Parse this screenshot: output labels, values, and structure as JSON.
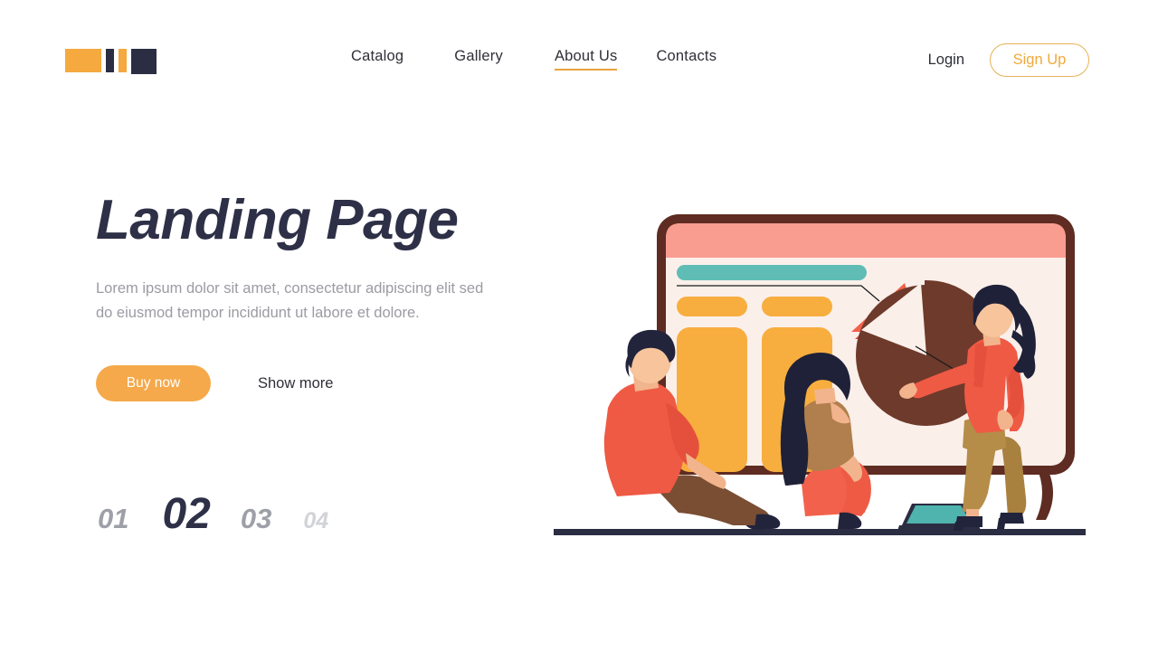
{
  "header": {
    "logo": {
      "name": "brand-logo",
      "colors": [
        "#F5A93F",
        "#2B2D42",
        "#F5A93F",
        "#2B2D42"
      ]
    },
    "nav": [
      {
        "label": "Catalog",
        "active": false
      },
      {
        "label": "Gallery",
        "active": false
      },
      {
        "label": "About Us",
        "active": true
      },
      {
        "label": "Contacts",
        "active": false
      }
    ],
    "login_label": "Login",
    "signup_label": "Sign Up"
  },
  "hero": {
    "title": "Landing Page",
    "subtitle": "Lorem ipsum dolor sit amet, consectetur adipiscing elit sed do eiusmod tempor incididunt ut labore et dolore.",
    "primary_cta": "Buy now",
    "secondary_cta": "Show more"
  },
  "slides": {
    "items": [
      {
        "label": "01",
        "active": false
      },
      {
        "label": "02",
        "active": true
      },
      {
        "label": "03",
        "active": false
      },
      {
        "label": "04",
        "active": false
      }
    ],
    "active_index": 1
  },
  "illustration": {
    "name": "business-presentation-illustration",
    "description": "Three people around a presentation board with bar chart and exploded pie chart",
    "board": {
      "frame_color": "#5E2C22",
      "header_color": "#F99D90",
      "body_color": "#FBEFEA",
      "title_bar_color": "#5FBDB6",
      "bar_color": "#F7AE3E",
      "bars": [
        {
          "label": "bar-1-small"
        },
        {
          "label": "bar-2-small"
        },
        {
          "label": "bar-1-tall"
        },
        {
          "label": "bar-2-tall"
        }
      ]
    },
    "pie": {
      "main_color": "#6E3A2B",
      "slice_color": "#F2614C",
      "slice_exploded": true
    },
    "people": [
      {
        "name": "seated-man",
        "shirt_color": "#EF5A45",
        "pants_color": "#6E4430",
        "hair_color": "#22243C"
      },
      {
        "name": "seated-woman",
        "top_color": "#B07F4D",
        "skirt_color": "#F2614C",
        "hair_color": "#1F2138"
      },
      {
        "name": "presenter-woman",
        "blazer_color": "#EF5A45",
        "pants_color": "#A8813F",
        "hair_color": "#1F2138"
      }
    ],
    "laptop_screen_color": "#4FB3AE",
    "ground_color": "#2B2D42"
  },
  "colors": {
    "accent_orange": "#F5A94A",
    "dark_navy": "#2E3047",
    "muted_grey": "#9B9BA3",
    "teal": "#5FBDB6",
    "coral": "#EF5A45",
    "brown": "#6E3A2B"
  }
}
